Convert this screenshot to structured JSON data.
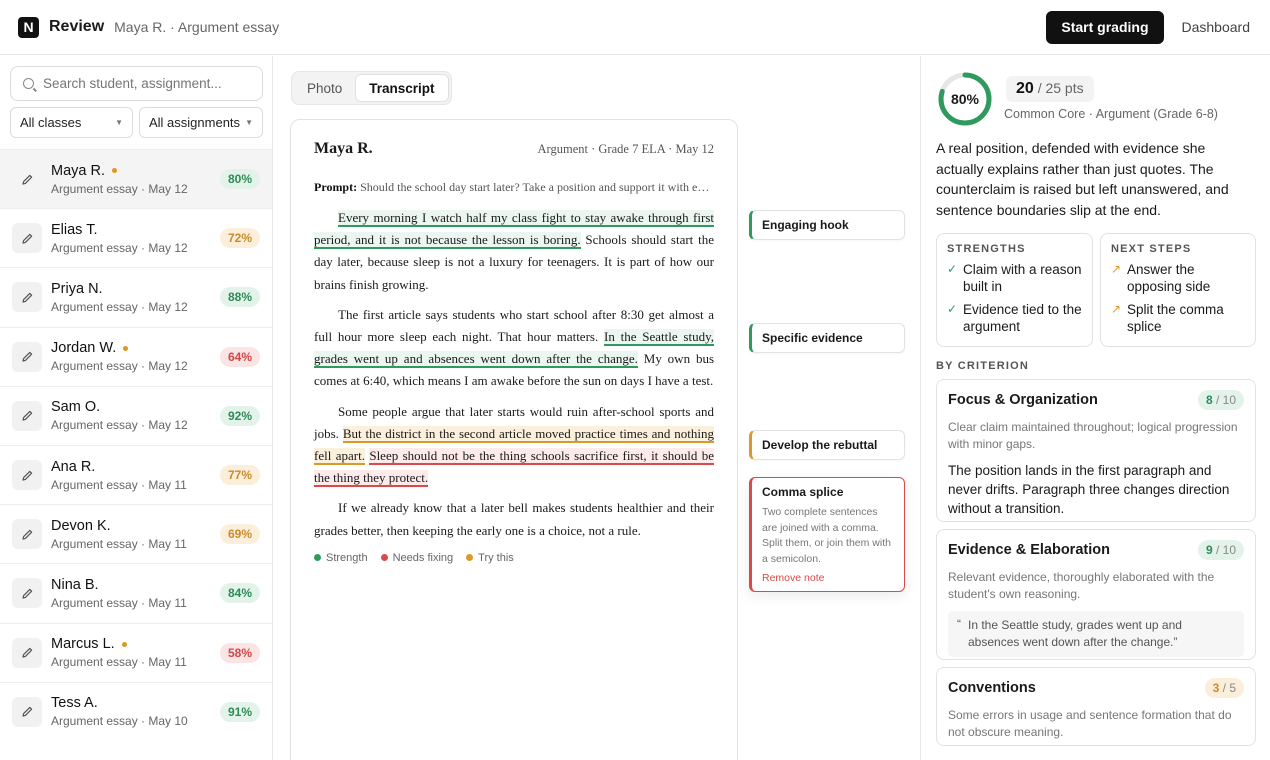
{
  "header": {
    "logo_letter": "N",
    "app_title": "Review",
    "breadcrumb": "Maya R. · Argument essay",
    "start_grading": "Start grading",
    "dashboard": "Dashboard"
  },
  "sidebar": {
    "search_placeholder": "Search student, assignment...",
    "class_filter": "All classes",
    "assignment_filter": "All assignments",
    "students": [
      {
        "name": "Maya R.",
        "sub": "Argument essay · May 12",
        "score": "80%",
        "tone": "green",
        "flag": true,
        "active": true
      },
      {
        "name": "Elias T.",
        "sub": "Argument essay · May 12",
        "score": "72%",
        "tone": "amber",
        "flag": false,
        "active": false
      },
      {
        "name": "Priya N.",
        "sub": "Argument essay · May 12",
        "score": "88%",
        "tone": "green",
        "flag": false,
        "active": false
      },
      {
        "name": "Jordan W.",
        "sub": "Argument essay · May 12",
        "score": "64%",
        "tone": "red",
        "flag": true,
        "active": false
      },
      {
        "name": "Sam O.",
        "sub": "Argument essay · May 12",
        "score": "92%",
        "tone": "green",
        "flag": false,
        "active": false
      },
      {
        "name": "Ana R.",
        "sub": "Argument essay · May 11",
        "score": "77%",
        "tone": "amber",
        "flag": false,
        "active": false
      },
      {
        "name": "Devon K.",
        "sub": "Argument essay · May 11",
        "score": "69%",
        "tone": "amber",
        "flag": false,
        "active": false
      },
      {
        "name": "Nina B.",
        "sub": "Argument essay · May 11",
        "score": "84%",
        "tone": "green",
        "flag": false,
        "active": false
      },
      {
        "name": "Marcus L.",
        "sub": "Argument essay · May 11",
        "score": "58%",
        "tone": "red",
        "flag": true,
        "active": false
      },
      {
        "name": "Tess A.",
        "sub": "Argument essay · May 10",
        "score": "91%",
        "tone": "green",
        "flag": false,
        "active": false
      }
    ]
  },
  "viewer": {
    "tabs": [
      "Photo",
      "Transcript"
    ],
    "active_tab": "Transcript",
    "student": "Maya R.",
    "meta": "Argument · Grade 7 ELA · May 12",
    "prompt_label": "Prompt:",
    "prompt": "Should the school day start later? Take a position and support it with evidence from both articles.",
    "paragraphs": [
      [
        {
          "t": "Every morning I watch half my class fight to stay awake through first period, and it is not because the lesson is boring.",
          "h": "g"
        },
        {
          "t": " Schools should start the day later, because sleep is not a luxury for teenagers. It is part of how our brains finish growing.",
          "h": ""
        }
      ],
      [
        {
          "t": "The first article says students who start school after 8:30 get almost a full hour more sleep each night. That hour matters. ",
          "h": ""
        },
        {
          "t": "In the Seattle study, grades went up and absences went down after the change.",
          "h": "g"
        },
        {
          "t": " My own bus comes at 6:40, which means I am awake before the sun on days I have a test.",
          "h": ""
        }
      ],
      [
        {
          "t": "Some people argue that later starts would ruin after-school sports and jobs. ",
          "h": ""
        },
        {
          "t": "But the district in the second article moved practice times and nothing fell apart.",
          "h": "a"
        },
        {
          "t": " ",
          "h": ""
        },
        {
          "t": "Sleep should not be the thing schools sacrifice first, it should be the thing they protect.",
          "h": "r"
        }
      ],
      [
        {
          "t": "If we already know that a later bell makes students healthier and their grades better, then keeping the early one is a choice, not a rule.",
          "h": ""
        }
      ]
    ],
    "legend": [
      "Strength",
      "Needs fixing",
      "Try this"
    ],
    "legend_colors": [
      "#2e9a5e",
      "#d94a4a",
      "#d99a2b"
    ],
    "notes": [
      {
        "title": "Engaging hook",
        "tone": "g"
      },
      {
        "title": "Specific evidence",
        "tone": "g"
      },
      {
        "title": "Develop the rebuttal",
        "tone": "a"
      },
      {
        "title": "Comma splice",
        "tone": "r",
        "body": "Two complete sentences are joined with a comma. Split them, or join them with a semicolon.",
        "link": "Remove note"
      }
    ]
  },
  "grade": {
    "percent_label": "80%",
    "percent_value": 0.8,
    "points": "20",
    "points_total": "/ 25 pts",
    "standard": "Common Core · Argument (Grade 6-8)",
    "summary": "A real position, defended with evidence she actually explains rather than just quotes. The counterclaim is raised but left unanswered, and sentence boundaries slip at the end.",
    "strengths_title": "STRENGTHS",
    "strengths": [
      "Claim with a reason built in",
      "Evidence tied to the argument"
    ],
    "next_title": "NEXT STEPS",
    "next_steps": [
      "Answer the opposing side",
      "Split the comma splice"
    ],
    "criterion_title": "BY CRITERION",
    "criteria": [
      {
        "title": "Focus & Organization",
        "score": "8",
        "den": "/ 10",
        "tone": "green",
        "desc": "Clear claim maintained throughout; logical progression with minor gaps.",
        "body": "The position lands in the first paragraph and never drifts. Paragraph three changes direction without a transition."
      },
      {
        "title": "Evidence & Elaboration",
        "score": "9",
        "den": "/ 10",
        "tone": "green",
        "desc": "Relevant evidence, thoroughly elaborated with the student's own reasoning.",
        "quote": "In the Seattle study, grades went up and absences went down after the change.”"
      },
      {
        "title": "Conventions",
        "score": "3",
        "den": "/ 5",
        "tone": "amber",
        "desc": "Some errors in usage and sentence formation that do not obscure meaning."
      }
    ],
    "colors": {
      "ring": "#2e9a5e",
      "ring_track": "#e6e6e6",
      "check": "#2e9a5e",
      "arrow": "#d99a2b"
    }
  }
}
